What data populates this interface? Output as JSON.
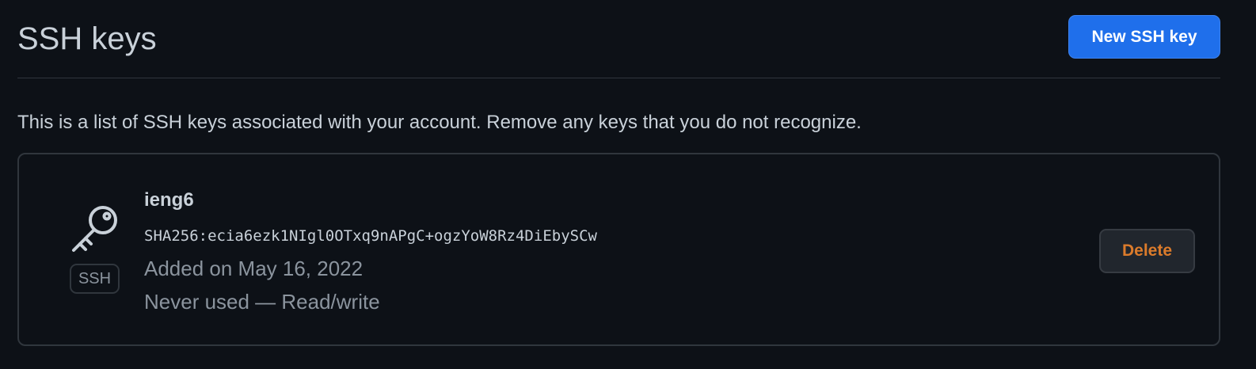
{
  "header": {
    "title": "SSH keys",
    "new_key_label": "New SSH key"
  },
  "description": "This is a list of SSH keys associated with your account. Remove any keys that you do not recognize.",
  "keys": [
    {
      "icon": "key-icon",
      "type_badge": "SSH",
      "title": "ieng6",
      "fingerprint": "SHA256:ecia6ezk1NIgl0OTxq9nAPgC+ogzYoW8Rz4DiEbySCw",
      "added_on": "Added on May 16, 2022",
      "usage": "Never used — Read/write",
      "delete_label": "Delete"
    }
  ],
  "colors": {
    "background": "#0d1117",
    "primary_button": "#1f6feb",
    "danger_text": "#db7b2b",
    "muted_text": "#8b949e",
    "border": "#30363d"
  }
}
